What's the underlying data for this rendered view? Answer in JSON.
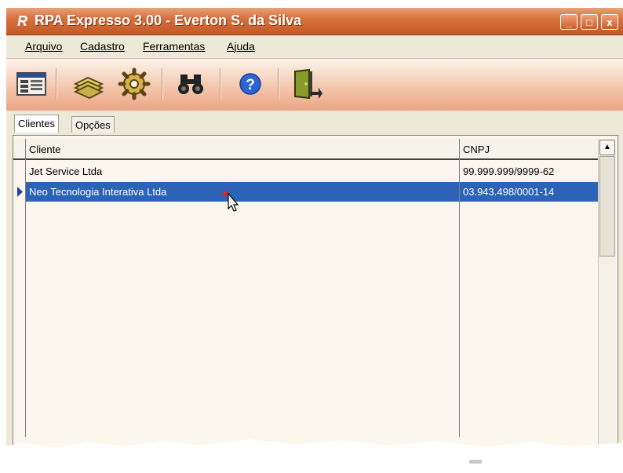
{
  "window": {
    "title": "RPA Expresso 3.00 - Everton S. da Silva",
    "app_icon_letter": "R",
    "controls": {
      "minimize": "_",
      "maximize": "□",
      "close": "x"
    }
  },
  "menu": {
    "items": [
      "Arquivo",
      "Cadastro",
      "Ferramentas",
      "Ajuda"
    ]
  },
  "toolbar": {
    "buttons": [
      "id-card-icon",
      "stacked-papers-icon",
      "gear-icon",
      "binoculars-icon",
      "help-icon",
      "exit-door-icon"
    ]
  },
  "tabs": [
    {
      "label": "Clientes",
      "active": true
    },
    {
      "label": "Opções",
      "active": false
    }
  ],
  "grid": {
    "columns": [
      "Cliente",
      "CNPJ"
    ],
    "rows": [
      {
        "cliente": "Jet Service Ltda",
        "cnpj": "99.999.999/9999-62"
      },
      {
        "cliente": "Neo Tecnologia Interativa Ltda",
        "cnpj": "03.943.498/0001-14"
      }
    ],
    "selected_row": 1
  },
  "colors": {
    "title_bar": "#d8703d",
    "selection": "#2c63b7",
    "window_bg": "#ece9d8"
  }
}
